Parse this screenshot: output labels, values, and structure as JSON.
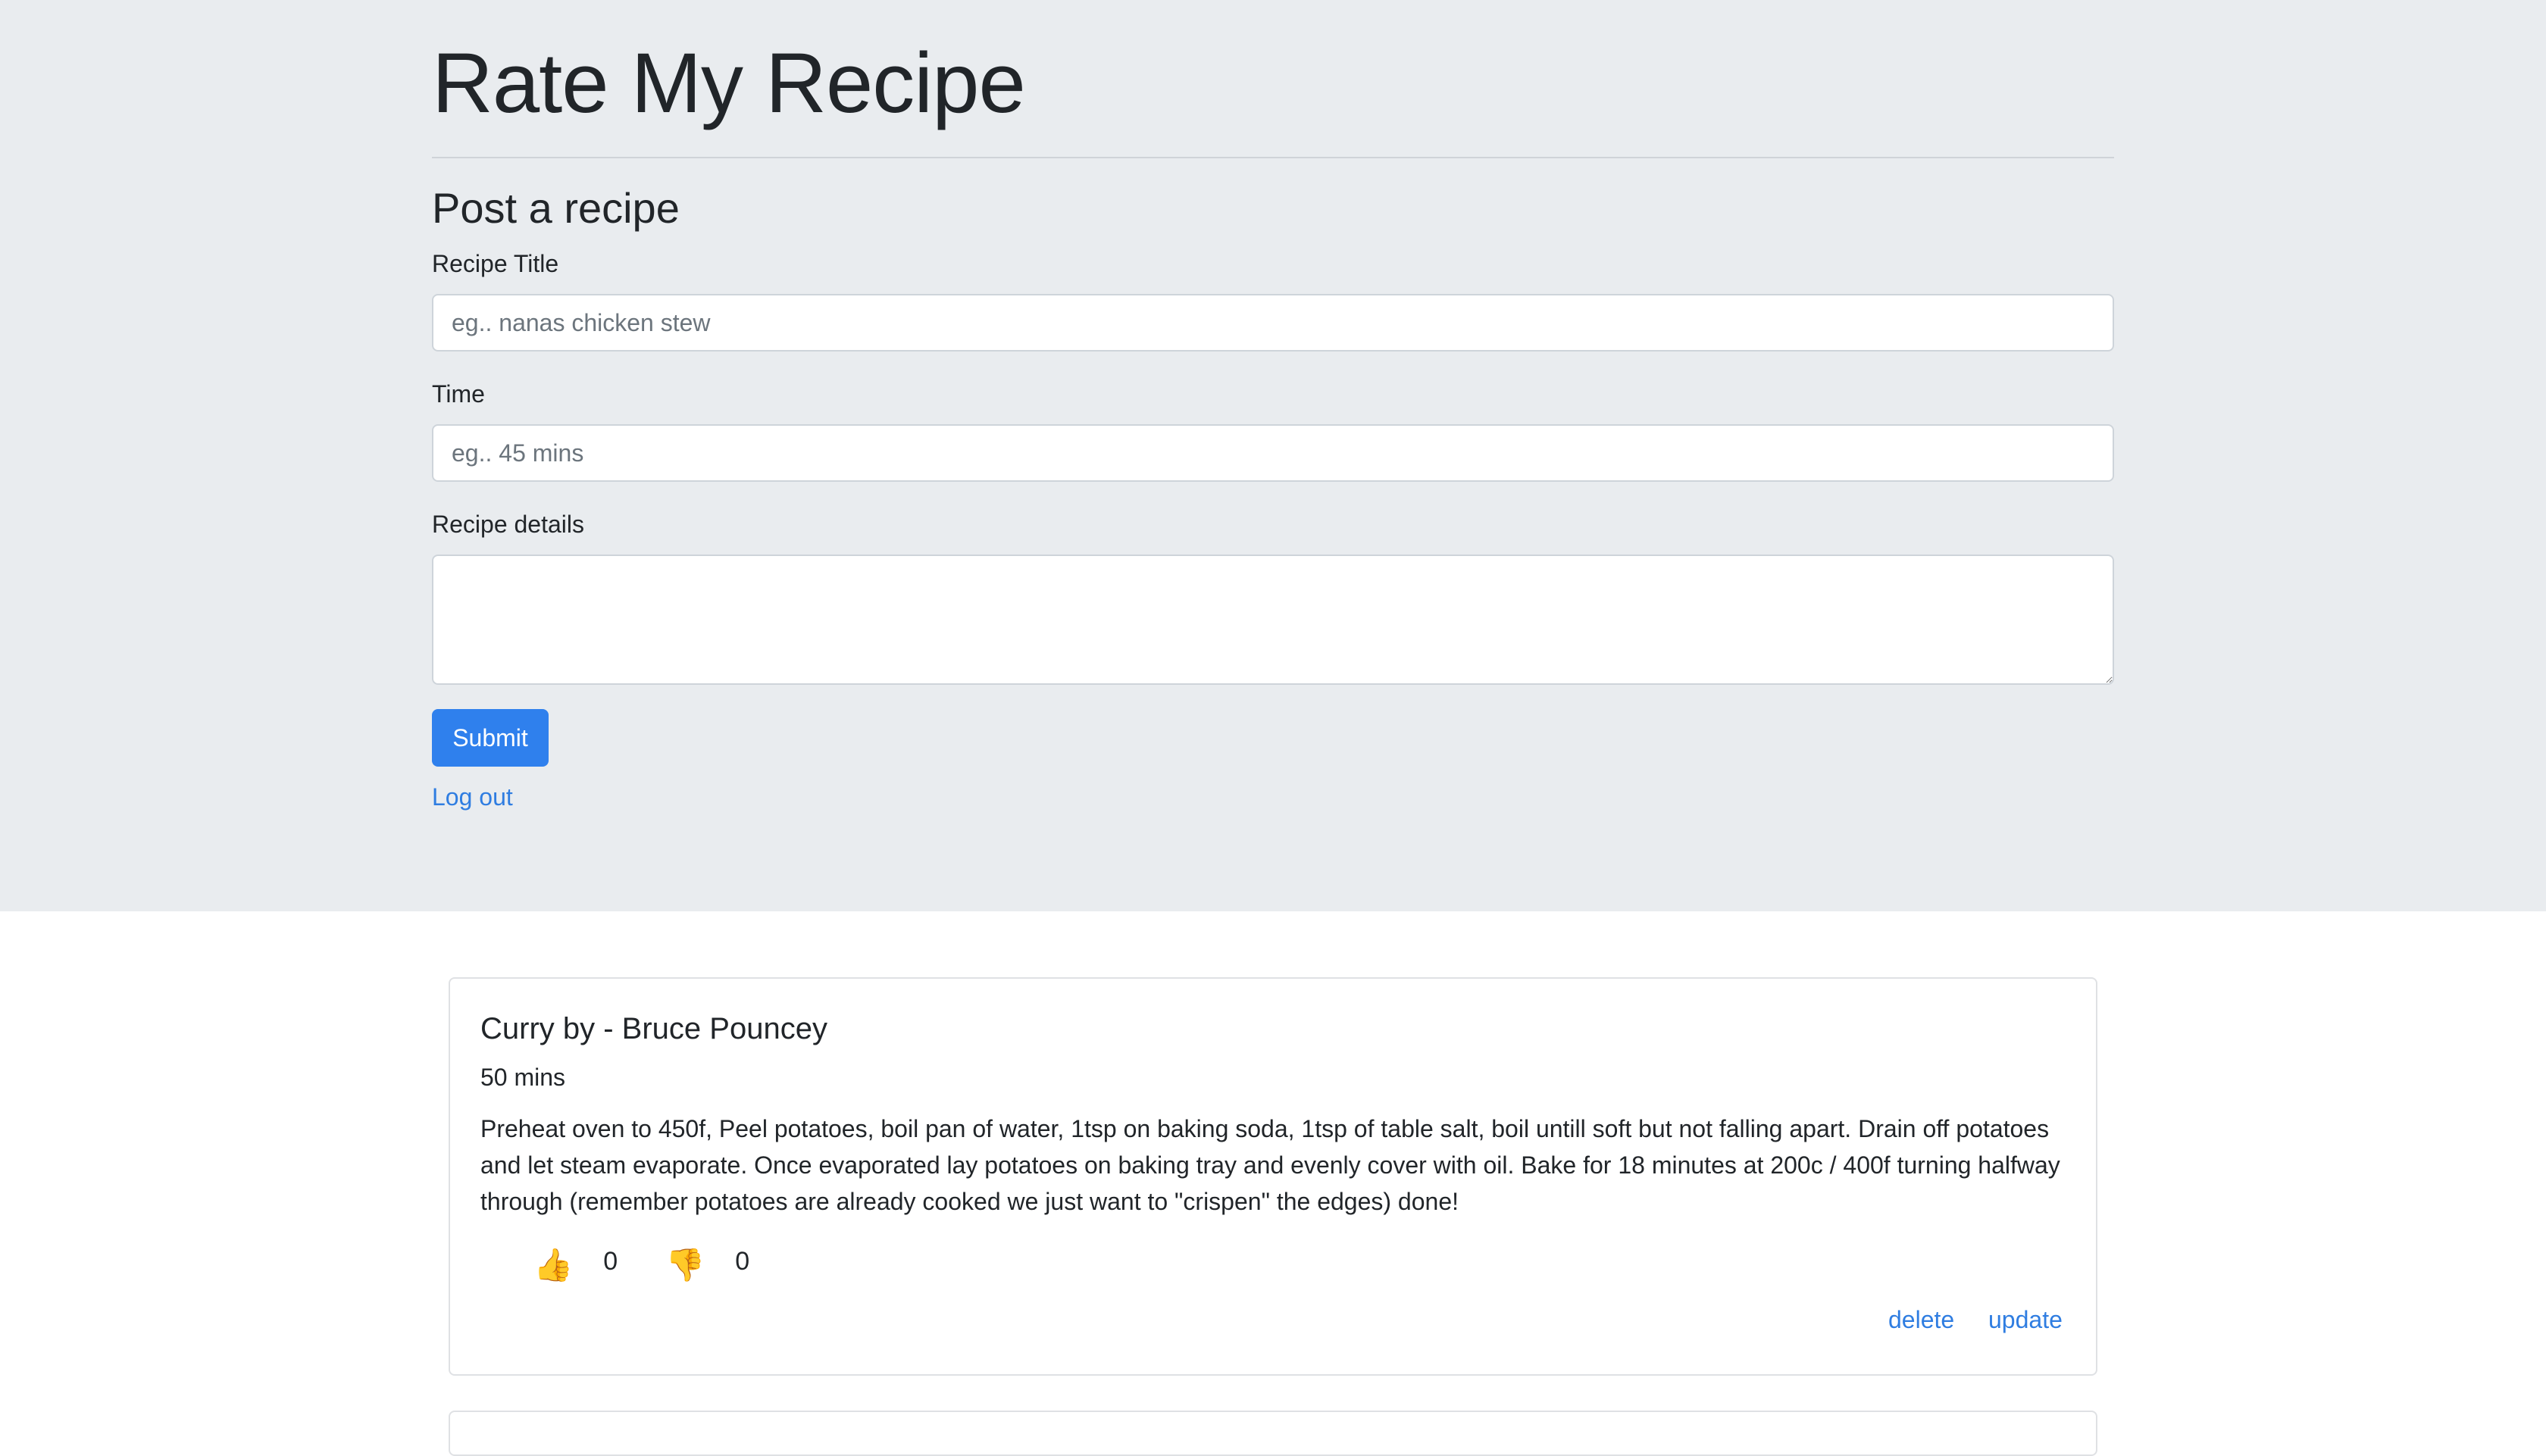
{
  "header": {
    "title": "Rate My Recipe"
  },
  "form": {
    "heading": "Post a recipe",
    "title_label": "Recipe Title",
    "title_placeholder": "eg.. nanas chicken stew",
    "time_label": "Time",
    "time_placeholder": "eg.. 45 mins",
    "details_label": "Recipe details",
    "details_value": "",
    "submit_label": "Submit",
    "logout_label": "Log out"
  },
  "recipes": [
    {
      "title": "Curry by - Bruce Pouncey",
      "time": "50 mins",
      "details": "Preheat oven to 450f, Peel potatoes, boil pan of water, 1tsp on baking soda, 1tsp of table salt, boil untill soft but not falling apart. Drain off potatoes and let steam evaporate. Once evaporated lay potatoes on baking tray and evenly cover with oil. Bake for 18 minutes at 200c / 400f turning halfway through (remember potatoes are already cooked we just want to \"crispen\" the edges) done!",
      "thumbs_up_icon": "👍",
      "thumbs_up_count": "0",
      "thumbs_down_icon": "👎",
      "thumbs_down_count": "0",
      "delete_label": "delete",
      "update_label": "update"
    }
  ],
  "colors": {
    "header_bg": "#e9ecef",
    "primary": "#2f80ed",
    "link": "#2f7de1"
  }
}
